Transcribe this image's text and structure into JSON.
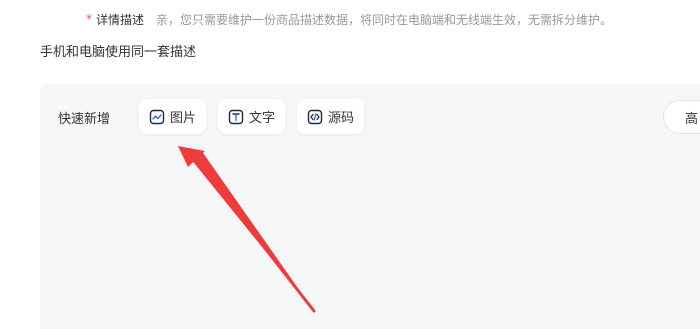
{
  "detail_field": {
    "required_mark": "*",
    "label": "详情描述",
    "hint": "亲，您只需要维护一份商品描述数据，将同时在电脑端和无线端生效，无需拆分维护。"
  },
  "sync_option": {
    "label": "手机和电脑使用同一套描述"
  },
  "editor": {
    "quick_add_label": "快速新增",
    "buttons": [
      {
        "label": "图片",
        "icon": "image-icon"
      },
      {
        "label": "文字",
        "icon": "text-icon"
      },
      {
        "label": "源码",
        "icon": "code-icon"
      }
    ],
    "advanced_label": "高"
  },
  "colors": {
    "accent": "#2f6cf6",
    "required": "#ff4d4f",
    "annotation_arrow": "#ee3b3b",
    "panel_bg": "#f5f6f8"
  }
}
